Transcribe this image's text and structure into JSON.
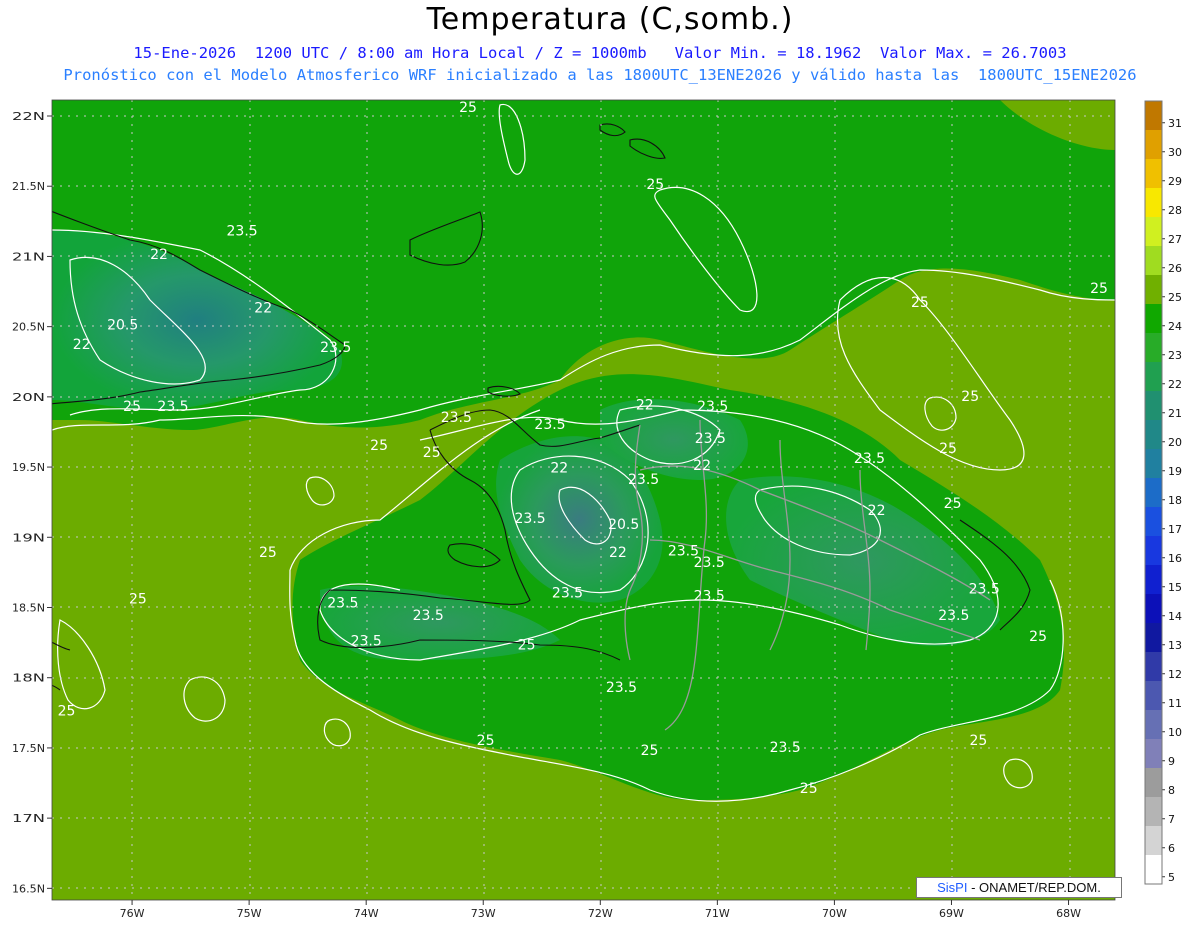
{
  "header": {
    "title": "Temperatura (C,somb.)",
    "line1": "15-Ene-2026  1200 UTC / 8:00 am Hora Local / Z = 1000mb   Valor Min. = 18.1962  Valor Max. = 26.7003",
    "line2": "Pronóstico con el Modelo Atmosferico WRF inicializado a las 1800UTC_13ENE2026 y válido hasta las  1800UTC_15ENE2026"
  },
  "axes": {
    "lat_labels": [
      "22N",
      "21.5N",
      "21N",
      "20.5N",
      "20N",
      "19.5N",
      "19N",
      "18.5N",
      "18N",
      "17.5N",
      "17N",
      "16.5N"
    ],
    "lon_labels": [
      "76W",
      "75W",
      "74W",
      "73W",
      "72W",
      "71W",
      "70W",
      "69W",
      "68W"
    ]
  },
  "contour_labels": [
    {
      "text": "25",
      "lon": -73.13,
      "lat": 22.03
    },
    {
      "text": "25",
      "lon": -71.53,
      "lat": 21.48
    },
    {
      "text": "23.5",
      "lon": -75.06,
      "lat": 21.15
    },
    {
      "text": "22",
      "lon": -75.77,
      "lat": 20.98
    },
    {
      "text": "22",
      "lon": -74.88,
      "lat": 20.6
    },
    {
      "text": "20.5",
      "lon": -76.08,
      "lat": 20.48
    },
    {
      "text": "22",
      "lon": -76.43,
      "lat": 20.34
    },
    {
      "text": "23.5",
      "lon": -74.26,
      "lat": 20.32
    },
    {
      "text": "25",
      "lon": -76.0,
      "lat": 19.9
    },
    {
      "text": "23.5",
      "lon": -75.65,
      "lat": 19.9
    },
    {
      "text": "25",
      "lon": -69.27,
      "lat": 20.64
    },
    {
      "text": "25",
      "lon": -67.74,
      "lat": 20.74
    },
    {
      "text": "25",
      "lon": -68.84,
      "lat": 19.97
    },
    {
      "text": "25",
      "lon": -73.89,
      "lat": 19.62
    },
    {
      "text": "23.5",
      "lon": -73.23,
      "lat": 19.82
    },
    {
      "text": "23.5",
      "lon": -72.43,
      "lat": 19.77
    },
    {
      "text": "25",
      "lon": -73.44,
      "lat": 19.57
    },
    {
      "text": "22",
      "lon": -71.62,
      "lat": 19.91
    },
    {
      "text": "23.5",
      "lon": -71.04,
      "lat": 19.9
    },
    {
      "text": "23.5",
      "lon": -71.06,
      "lat": 19.67
    },
    {
      "text": "22",
      "lon": -71.13,
      "lat": 19.48
    },
    {
      "text": "22",
      "lon": -72.35,
      "lat": 19.46
    },
    {
      "text": "23.5",
      "lon": -71.63,
      "lat": 19.38
    },
    {
      "text": "23.5",
      "lon": -69.7,
      "lat": 19.53
    },
    {
      "text": "25",
      "lon": -69.03,
      "lat": 19.6
    },
    {
      "text": "25",
      "lon": -68.99,
      "lat": 19.21
    },
    {
      "text": "22",
      "lon": -69.64,
      "lat": 19.16
    },
    {
      "text": "23.5",
      "lon": -72.6,
      "lat": 19.1
    },
    {
      "text": "20.5",
      "lon": -71.8,
      "lat": 19.06
    },
    {
      "text": "22",
      "lon": -71.85,
      "lat": 18.86
    },
    {
      "text": "23.5",
      "lon": -71.07,
      "lat": 18.79
    },
    {
      "text": "23.5",
      "lon": -71.29,
      "lat": 18.87
    },
    {
      "text": "25",
      "lon": -74.84,
      "lat": 18.86
    },
    {
      "text": "23.5",
      "lon": -72.28,
      "lat": 18.57
    },
    {
      "text": "23.5",
      "lon": -71.07,
      "lat": 18.55
    },
    {
      "text": "23.5",
      "lon": -74.2,
      "lat": 18.5
    },
    {
      "text": "23.5",
      "lon": -73.47,
      "lat": 18.41
    },
    {
      "text": "23.5",
      "lon": -74.0,
      "lat": 18.23
    },
    {
      "text": "25",
      "lon": -72.63,
      "lat": 18.2
    },
    {
      "text": "25",
      "lon": -75.95,
      "lat": 18.53
    },
    {
      "text": "23.5",
      "lon": -68.72,
      "lat": 18.6
    },
    {
      "text": "23.5",
      "lon": -68.98,
      "lat": 18.41
    },
    {
      "text": "25",
      "lon": -68.26,
      "lat": 18.26
    },
    {
      "text": "23.5",
      "lon": -71.82,
      "lat": 17.9
    },
    {
      "text": "25",
      "lon": -76.56,
      "lat": 17.73
    },
    {
      "text": "25",
      "lon": -72.98,
      "lat": 17.52
    },
    {
      "text": "25",
      "lon": -71.58,
      "lat": 17.45
    },
    {
      "text": "23.5",
      "lon": -70.42,
      "lat": 17.47
    },
    {
      "text": "25",
      "lon": -70.22,
      "lat": 17.18
    },
    {
      "text": "25",
      "lon": -68.77,
      "lat": 17.52
    }
  ],
  "colorbar": {
    "levels": [
      "31",
      "30",
      "29",
      "28",
      "27",
      "26",
      "25",
      "24",
      "23",
      "22",
      "21",
      "20",
      "19",
      "18",
      "17",
      "16",
      "15",
      "14",
      "13",
      "12",
      "11",
      "10",
      "9",
      "8",
      "7",
      "6",
      "5"
    ],
    "colors": [
      "#c07800",
      "#e0a000",
      "#f0c000",
      "#f8e800",
      "#d0f020",
      "#a0dc20",
      "#70b000",
      "#10a800",
      "#28ac28",
      "#20a050",
      "#209070",
      "#208888",
      "#2080a0",
      "#1c6cc8",
      "#1a50e0",
      "#1838e0",
      "#1020d0",
      "#0c10b8",
      "#1018a0",
      "#303aa8",
      "#4c58b0",
      "#6670b4",
      "#8080b8",
      "#9c9c9c",
      "#b4b4b4",
      "#d4d4d4",
      "#ffffff"
    ]
  },
  "footer": {
    "brand": "SisPI",
    "credit": " - ONAMET/REP.DOM."
  }
}
